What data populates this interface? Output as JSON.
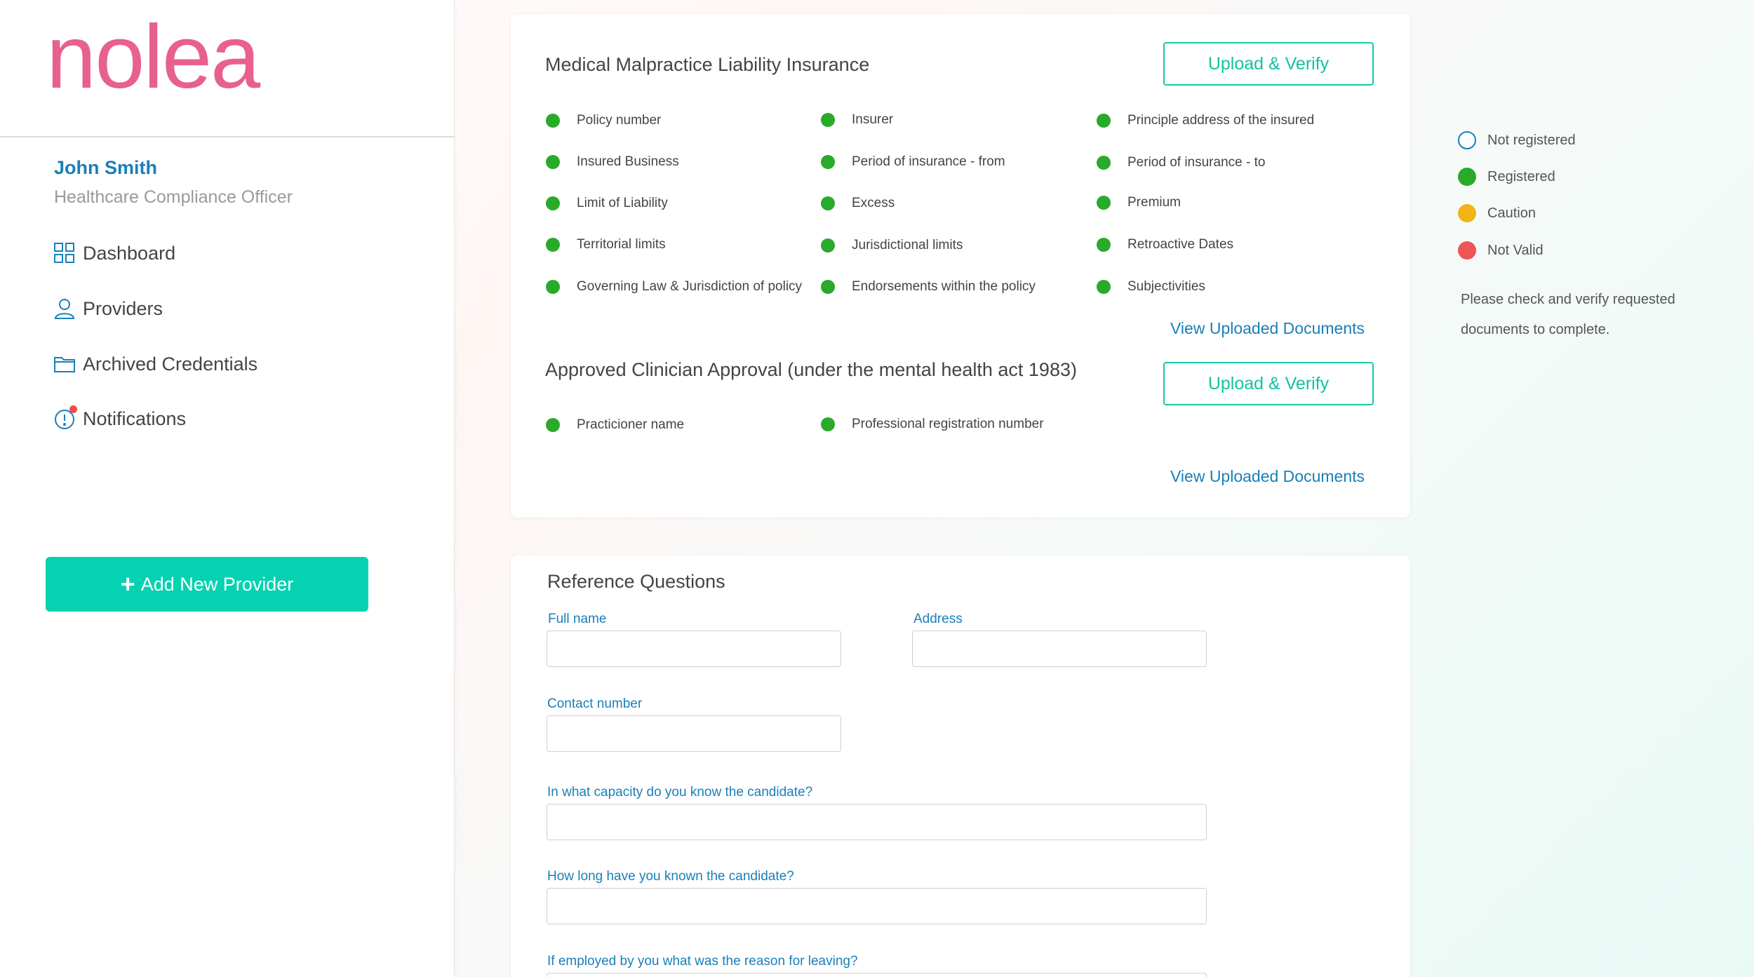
{
  "brand": {
    "logo_text": "nolea",
    "logo_color": "#e8608e",
    "accent_color": "#05d2b0",
    "link_color": "#1a7fb8"
  },
  "user": {
    "name": "John Smith",
    "role": "Healthcare Compliance Officer"
  },
  "nav": {
    "items": [
      {
        "label": "Dashboard",
        "icon": "grid-icon"
      },
      {
        "label": "Providers",
        "icon": "user-icon"
      },
      {
        "label": "Archived Credentials",
        "icon": "folder-icon"
      },
      {
        "label": "Notifications",
        "icon": "alert-icon"
      }
    ]
  },
  "add_provider": {
    "label": "Add New Provider"
  },
  "sections": {
    "malpractice": {
      "title": "Medical Malpractice Liability Insurance",
      "upload_label": "Upload & Verify",
      "view_label": "View Uploaded Documents",
      "items": [
        "Policy number",
        "Insurer",
        "Principle address of the insured",
        "Insured Business",
        "Period of insurance - from",
        "Period of insurance - to",
        "Limit of Liability",
        "Excess",
        "Premium",
        "Territorial limits",
        "Jurisdictional limits",
        "Retroactive Dates",
        "Governing Law & Jurisdiction of policy",
        "Endorsements within the policy",
        "Subjectivities"
      ]
    },
    "clinician": {
      "title": "Approved Clinician Approval (under the mental health act 1983)",
      "upload_label": "Upload & Verify",
      "view_label": "View Uploaded Documents",
      "items": [
        "Practicioner name",
        "Professional registration number"
      ]
    }
  },
  "reference": {
    "title": "Reference Questions",
    "fields": {
      "full_name": {
        "label": "Full name",
        "value": ""
      },
      "address": {
        "label": "Address",
        "value": ""
      },
      "contact_number": {
        "label": "Contact number",
        "value": ""
      },
      "capacity": {
        "label": "In what capacity do you know the candidate?",
        "value": ""
      },
      "how_long": {
        "label": "How long have you known the candidate?",
        "value": ""
      },
      "reason_leaving": {
        "label": "If employed by you what was the reason for leaving?",
        "value": ""
      }
    }
  },
  "legend": {
    "items": [
      {
        "label": "Not registered",
        "color": "#1a7fb8"
      },
      {
        "label": "Registered",
        "color": "#2aaa2a"
      },
      {
        "label": "Caution",
        "color": "#f0b418"
      },
      {
        "label": "Not Valid",
        "color": "#ee5555"
      }
    ],
    "note": "Please check and verify requested documents to complete."
  },
  "status_colors": {
    "registered": "#2aaa2a"
  }
}
